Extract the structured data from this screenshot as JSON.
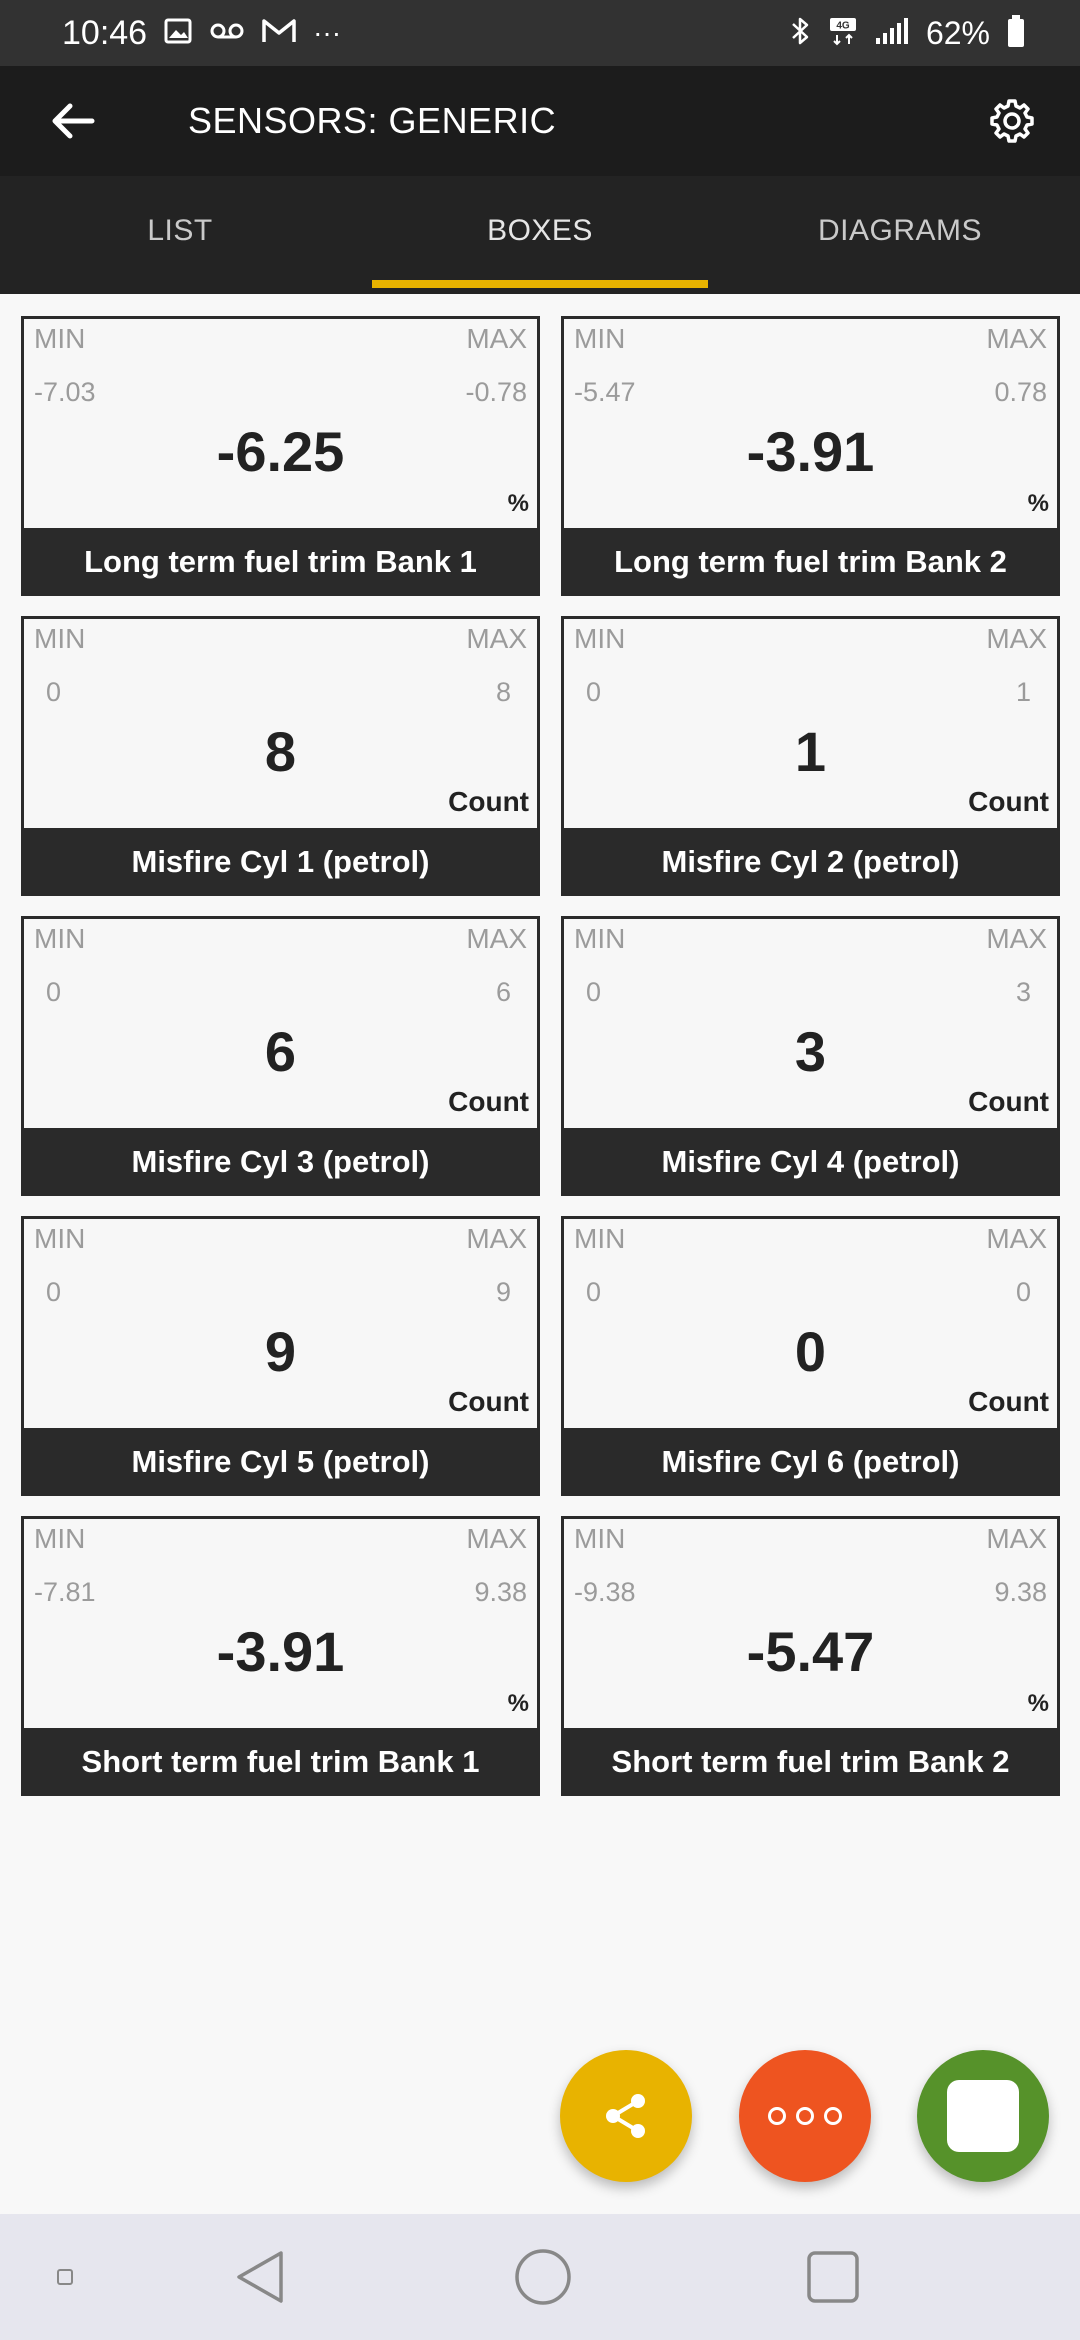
{
  "status_bar": {
    "time": "10:46",
    "left_icons": [
      "image-icon",
      "voicemail-icon",
      "gmail-icon",
      "more-notifications-icon"
    ],
    "right_icons": [
      "bluetooth-icon",
      "lte-icon",
      "signal-icon",
      "battery-icon"
    ],
    "more_glyph": "···",
    "battery": "62%"
  },
  "toolbar": {
    "title": "SENSORS: GENERIC"
  },
  "tabs": [
    {
      "label": "LIST",
      "active": false
    },
    {
      "label": "BOXES",
      "active": true
    },
    {
      "label": "DIAGRAMS",
      "active": false
    }
  ],
  "labels": {
    "min": "MIN",
    "max": "MAX"
  },
  "sensors": [
    {
      "name": "Long term fuel trim Bank 1",
      "min": "-7.03",
      "max": "-0.78",
      "value": "-6.25",
      "unit": "%"
    },
    {
      "name": "Long term fuel trim Bank 2",
      "min": "-5.47",
      "max": "0.78",
      "value": "-3.91",
      "unit": "%"
    },
    {
      "name": "Misfire Cyl 1 (petrol)",
      "min": "0",
      "max": "8",
      "value": "8",
      "unit": "Count"
    },
    {
      "name": "Misfire Cyl 2 (petrol)",
      "min": "0",
      "max": "1",
      "value": "1",
      "unit": "Count"
    },
    {
      "name": "Misfire Cyl 3 (petrol)",
      "min": "0",
      "max": "6",
      "value": "6",
      "unit": "Count"
    },
    {
      "name": "Misfire Cyl 4 (petrol)",
      "min": "0",
      "max": "3",
      "value": "3",
      "unit": "Count"
    },
    {
      "name": "Misfire Cyl 5 (petrol)",
      "min": "0",
      "max": "9",
      "value": "9",
      "unit": "Count"
    },
    {
      "name": "Misfire Cyl 6 (petrol)",
      "min": "0",
      "max": "0",
      "value": "0",
      "unit": "Count"
    },
    {
      "name": "Short term fuel trim Bank 1",
      "min": "-7.81",
      "max": "9.38",
      "value": "-3.91",
      "unit": "%"
    },
    {
      "name": "Short term fuel trim Bank 2",
      "min": "-9.38",
      "max": "9.38",
      "value": "-5.47",
      "unit": "%"
    }
  ],
  "fabs": {
    "share_icon": "share-icon",
    "more_icon": "more-options-icon",
    "stop_icon": "stop-icon"
  },
  "colors": {
    "accent": "#e8b300",
    "share": "#e8b300",
    "more": "#ee5420",
    "stop": "#56922a",
    "toolbar": "#1c1c1c",
    "box_label": "#2a2a2a"
  }
}
